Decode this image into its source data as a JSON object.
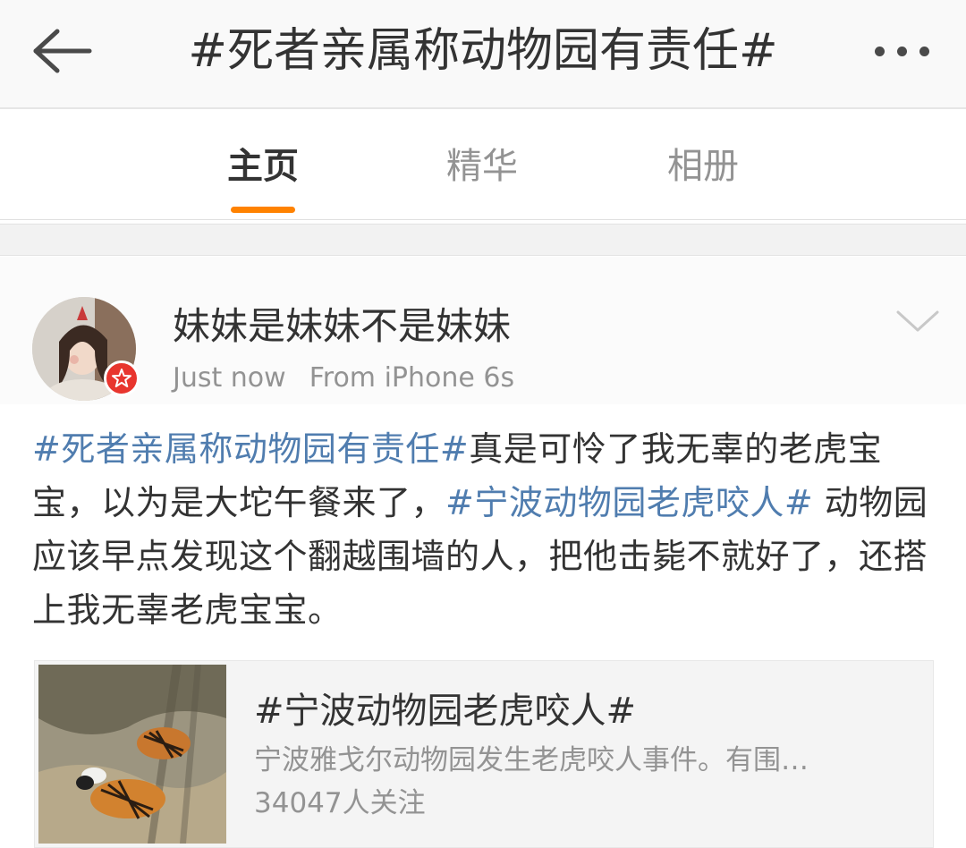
{
  "header": {
    "title": "#死者亲属称动物园有责任#",
    "back_icon": "back-arrow-icon",
    "more_icon": "more-dots-icon"
  },
  "tabs": [
    {
      "label": "主页",
      "active": true
    },
    {
      "label": "精华",
      "active": false
    },
    {
      "label": "相册",
      "active": false
    }
  ],
  "colors": {
    "accent": "#ff8200",
    "hashtag": "#507daf",
    "verified_badge": "#e8352e",
    "text_primary": "#333333",
    "text_secondary": "#939393"
  },
  "post": {
    "username": "妹妹是妹妹不是妹妹",
    "time": "Just now",
    "source": "From iPhone 6s",
    "body": [
      {
        "text": "#死者亲属称动物园有责任#",
        "hashtag": true
      },
      {
        "text": "真是可怜了我无辜的老虎宝宝，以为是大坨午餐来了，",
        "hashtag": false
      },
      {
        "text": "#宁波动物园老虎咬人#",
        "hashtag": true
      },
      {
        "text": " 动物园应该早点发现这个翻越围墙的人，把他击毙不就好了，还搭上我无辜老虎宝宝。",
        "hashtag": false
      }
    ]
  },
  "topic_card": {
    "title": "#宁波动物园老虎咬人#",
    "description": "宁波雅戈尔动物园发生老虎咬人事件。有围…",
    "followers": "34047人关注"
  }
}
